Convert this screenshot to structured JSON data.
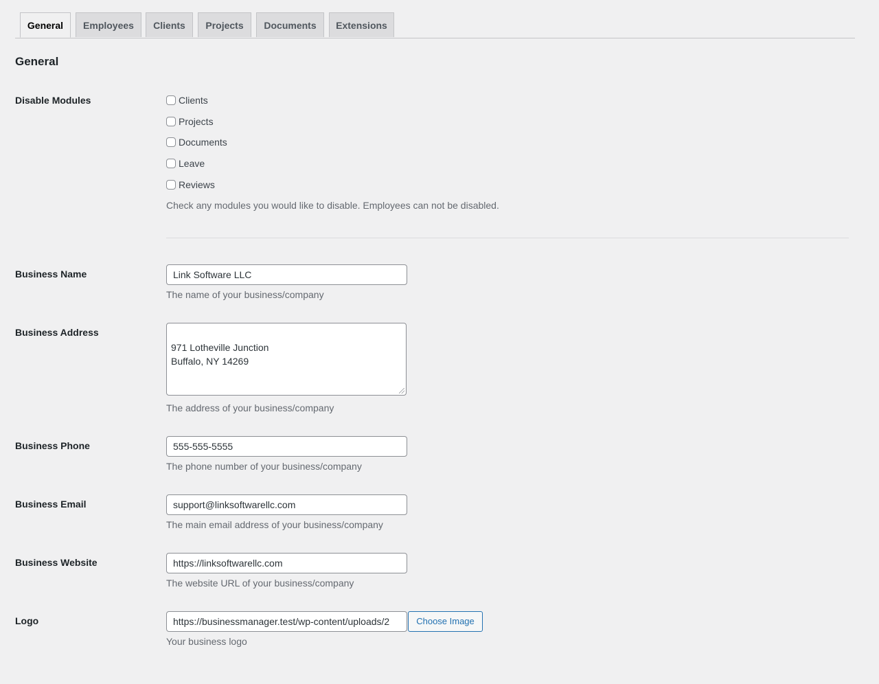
{
  "tabs": [
    {
      "label": "General",
      "active": true
    },
    {
      "label": "Employees",
      "active": false
    },
    {
      "label": "Clients",
      "active": false
    },
    {
      "label": "Projects",
      "active": false
    },
    {
      "label": "Documents",
      "active": false
    },
    {
      "label": "Extensions",
      "active": false
    }
  ],
  "section": {
    "title": "General"
  },
  "disable_modules": {
    "label": "Disable Modules",
    "options": [
      {
        "label": "Clients",
        "checked": false
      },
      {
        "label": "Projects",
        "checked": false
      },
      {
        "label": "Documents",
        "checked": false
      },
      {
        "label": "Leave",
        "checked": false
      },
      {
        "label": "Reviews",
        "checked": false
      }
    ],
    "description": "Check any modules you would like to disable. Employees can not be disabled."
  },
  "fields": {
    "business_name": {
      "label": "Business Name",
      "value": "Link Software LLC",
      "description": "The name of your business/company"
    },
    "business_address": {
      "label": "Business Address",
      "value": "971 Lotheville Junction\nBuffalo, NY 14269",
      "description": "The address of your business/company"
    },
    "business_phone": {
      "label": "Business Phone",
      "value": "555-555-5555",
      "description": "The phone number of your business/company"
    },
    "business_email": {
      "label": "Business Email",
      "value": "support@linksoftwarellc.com",
      "description": "The main email address of your business/company"
    },
    "business_website": {
      "label": "Business Website",
      "value": "https://linksoftwarellc.com",
      "description": "The website URL of your business/company"
    },
    "logo": {
      "label": "Logo",
      "value": "https://businessmanager.test/wp-content/uploads/2",
      "button_label": "Choose Image",
      "description": "Your business logo"
    }
  },
  "colors": {
    "background": "#f0f0f1",
    "accent": "#2271b1",
    "tab_inactive_bg": "#dcdcde",
    "description_text": "#646970"
  }
}
